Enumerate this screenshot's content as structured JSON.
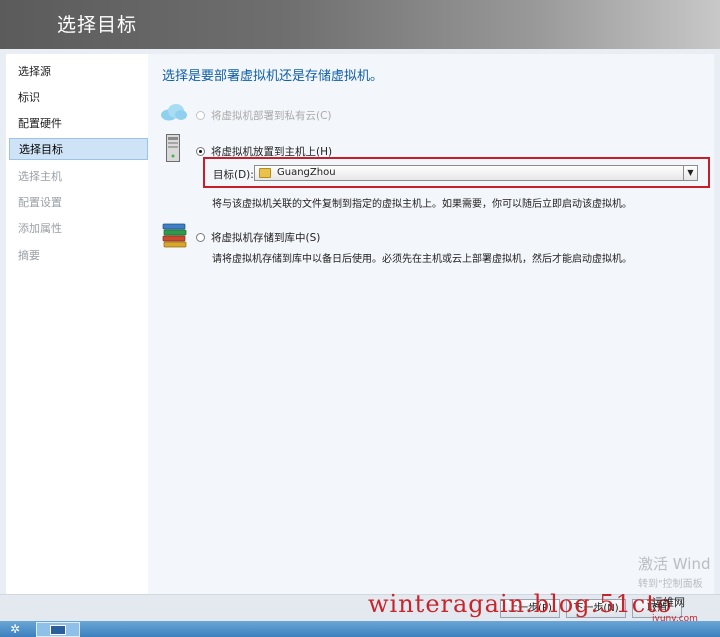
{
  "header": {
    "title": "选择目标"
  },
  "sidebar": {
    "items": [
      {
        "label": "选择源",
        "state": "normal"
      },
      {
        "label": "标识",
        "state": "normal"
      },
      {
        "label": "配置硬件",
        "state": "normal"
      },
      {
        "label": "选择目标",
        "state": "active"
      },
      {
        "label": "选择主机",
        "state": "disabled"
      },
      {
        "label": "配置设置",
        "state": "disabled"
      },
      {
        "label": "添加属性",
        "state": "disabled"
      },
      {
        "label": "摘要",
        "state": "disabled"
      }
    ]
  },
  "main": {
    "heading": "选择是要部署虚拟机还是存储虚拟机。",
    "option_cloud": {
      "label": "将虚拟机部署到私有云(C)",
      "checked": false,
      "enabled": false,
      "icon": "cloud-icon"
    },
    "option_host": {
      "label": "将虚拟机放置到主机上(H)",
      "checked": true,
      "enabled": true,
      "icon": "server-icon"
    },
    "target": {
      "label": "目标(D):",
      "value": "GuangZhou",
      "icon": "folder-icon"
    },
    "host_description": "将与该虚拟机关联的文件复制到指定的虚拟主机上。如果需要，你可以随后立即启动该虚拟机。",
    "option_library": {
      "label": "将虚拟机存储到库中(S)",
      "checked": false,
      "enabled": true,
      "icon": "library-books-icon"
    },
    "library_description": "请将虚拟机存储到库中以备日后使用。必须先在主机或云上部署虚拟机，然后才能启动虚拟机。"
  },
  "footer": {
    "prev_label": "上一步(P)",
    "next_label": "下一步(N)",
    "cancel_label": "取消"
  },
  "watermarks": {
    "activate_title": "激活 Wind",
    "activate_sub": "转到\"控制面板",
    "blog": "winteragain.blog.51cto",
    "site_name": "运维网",
    "site_url": "iyunv.com"
  },
  "colors": {
    "accent": "#0f5fa8",
    "highlight": "#c81e2a",
    "active_nav": "#cfe3f7"
  }
}
